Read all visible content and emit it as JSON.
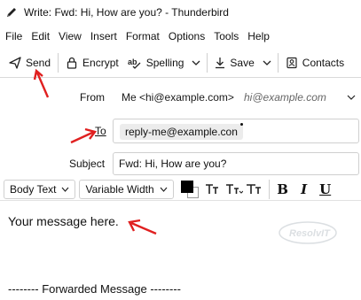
{
  "window": {
    "title": "Write: Fwd: Hi, How are you? - Thunderbird"
  },
  "menubar": {
    "items": [
      "File",
      "Edit",
      "View",
      "Insert",
      "Format",
      "Options",
      "Tools",
      "Help"
    ]
  },
  "toolbar": {
    "send_label": "Send",
    "encrypt_label": "Encrypt",
    "spelling_label": "Spelling",
    "save_label": "Save",
    "contacts_label": "Contacts"
  },
  "header": {
    "from_label": "From",
    "from_value": "Me <hi@example.com>",
    "from_hint": "hi@example.com",
    "to_label": "To",
    "to_recipient": "reply-me@example.con",
    "subject_label": "Subject",
    "subject_value": "Fwd: Hi, How are you?"
  },
  "format_toolbar": {
    "paragraph_format": "Body Text",
    "font": "Variable Width",
    "text_color": "#000000",
    "background_color": "#ffffff",
    "bold_label": "B",
    "italic_label": "I",
    "underline_label": "U"
  },
  "body": {
    "message": "Your message here.",
    "forwarded_header": "-------- Forwarded Message --------"
  },
  "watermark": {
    "text": "ResolvIT"
  },
  "colors": {
    "annotation_arrow": "#e02020",
    "accent": "#0060df"
  }
}
